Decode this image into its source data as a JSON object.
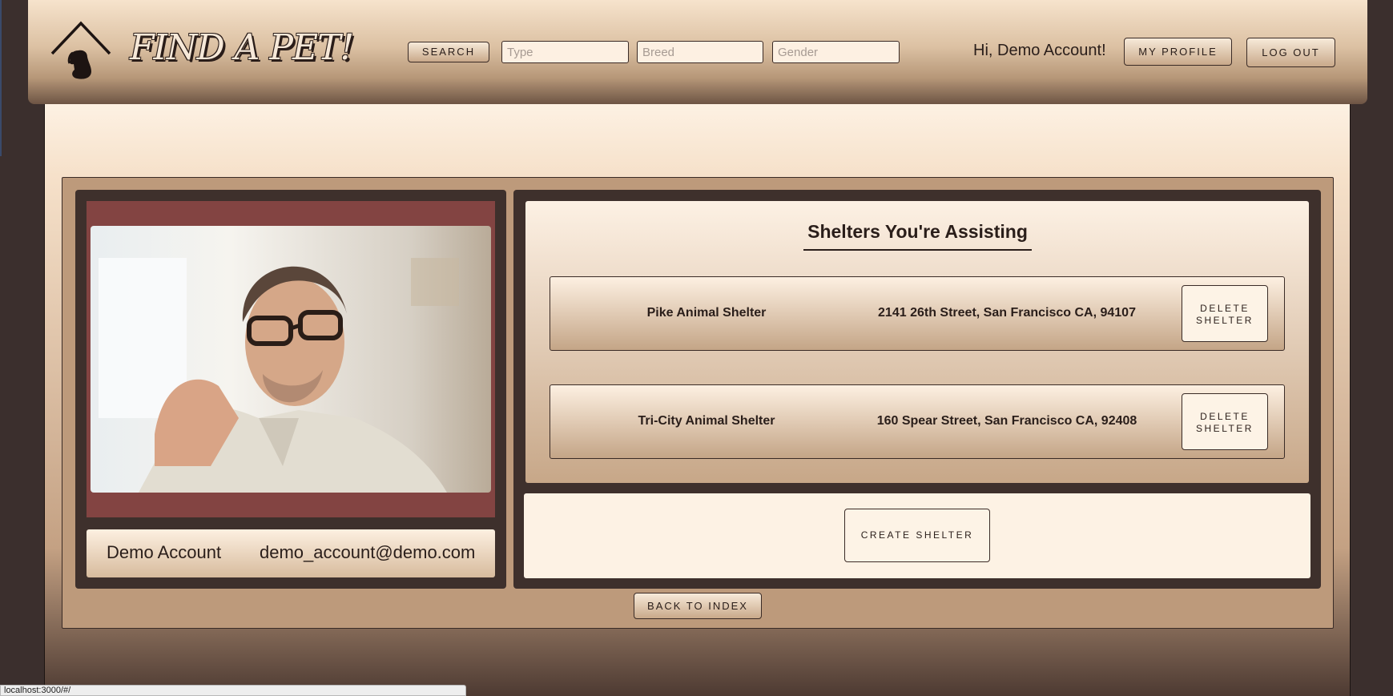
{
  "header": {
    "logo_text": "FIND A PET!",
    "search_label": "SEARCH",
    "type_placeholder": "Type",
    "breed_placeholder": "Breed",
    "gender_placeholder": "Gender",
    "greeting": "Hi, Demo Account!",
    "profile_label": "MY PROFILE",
    "logout_label": "LOG OUT"
  },
  "profile": {
    "name": "Demo Account",
    "email": "demo_account@demo.com",
    "photo_icon": "user-photo"
  },
  "shelters": {
    "title": "Shelters You're Assisting",
    "items": [
      {
        "name": "Pike Animal Shelter",
        "address": "2141 26th Street, San Francisco CA, 94107",
        "delete_label": "DELETE SHELTER"
      },
      {
        "name": "Tri-City Animal Shelter",
        "address": "160 Spear Street, San Francisco CA, 92408",
        "delete_label": "DELETE SHELTER"
      }
    ],
    "create_label": "CREATE SHELTER"
  },
  "back_label": "BACK TO INDEX",
  "status_url": "localhost:3000/#/",
  "colors": {
    "frame": "#3e302c",
    "photo_border": "#834442",
    "panel": "#bd9a7b",
    "text": "#2a1e1a"
  }
}
